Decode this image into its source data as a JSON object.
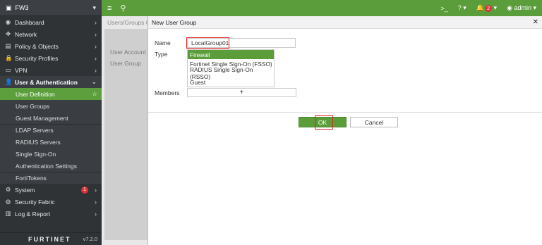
{
  "sidebar": {
    "device": "FW3",
    "items": [
      {
        "icon": "dashboard-icon",
        "glyph": "◉",
        "label": "Dashboard"
      },
      {
        "icon": "network-icon",
        "glyph": "✥",
        "label": "Network"
      },
      {
        "icon": "policy-icon",
        "glyph": "▤",
        "label": "Policy & Objects"
      },
      {
        "icon": "security-profiles-icon",
        "glyph": "🔒",
        "label": "Security Profiles"
      },
      {
        "icon": "vpn-icon",
        "glyph": "▭",
        "label": "VPN"
      }
    ],
    "section": {
      "icon": "user-icon",
      "glyph": "👤",
      "label": "User & Authentication"
    },
    "sub_items": [
      "User Definition",
      "User Groups",
      "Guest Management",
      "LDAP Servers",
      "RADIUS Servers",
      "Single Sign-On",
      "Authentication Settings",
      "FortiTokens"
    ],
    "bottom_items": [
      {
        "icon": "system-icon",
        "glyph": "⚙",
        "label": "System",
        "badge": "1"
      },
      {
        "icon": "security-fabric-icon",
        "glyph": "◍",
        "label": "Security Fabric"
      },
      {
        "icon": "log-report-icon",
        "glyph": "▥",
        "label": "Log & Report"
      }
    ],
    "logo": "FURTINET",
    "version": "v7.2.0"
  },
  "topbar": {
    "alerts_count": "2",
    "user": "admin"
  },
  "background": {
    "breadcrumb": "Users/Groups C",
    "labels": [
      "User Account",
      "User Group"
    ]
  },
  "dialog": {
    "title": "New User Group",
    "name_label": "Name",
    "name_value": "LocalGroup01",
    "type_label": "Type",
    "type_options": [
      "Firewall",
      "Fortinet Single Sign-On (FSSO)",
      "RADIUS Single Sign-On (RSSO)",
      "Guest"
    ],
    "members_label": "Members",
    "members_add": "+",
    "ok_label": "OK",
    "cancel_label": "Cancel"
  },
  "colors": {
    "accent": "#5b9d3a",
    "sidebar_bg": "#2f3336",
    "highlight_box": "#e02020"
  }
}
